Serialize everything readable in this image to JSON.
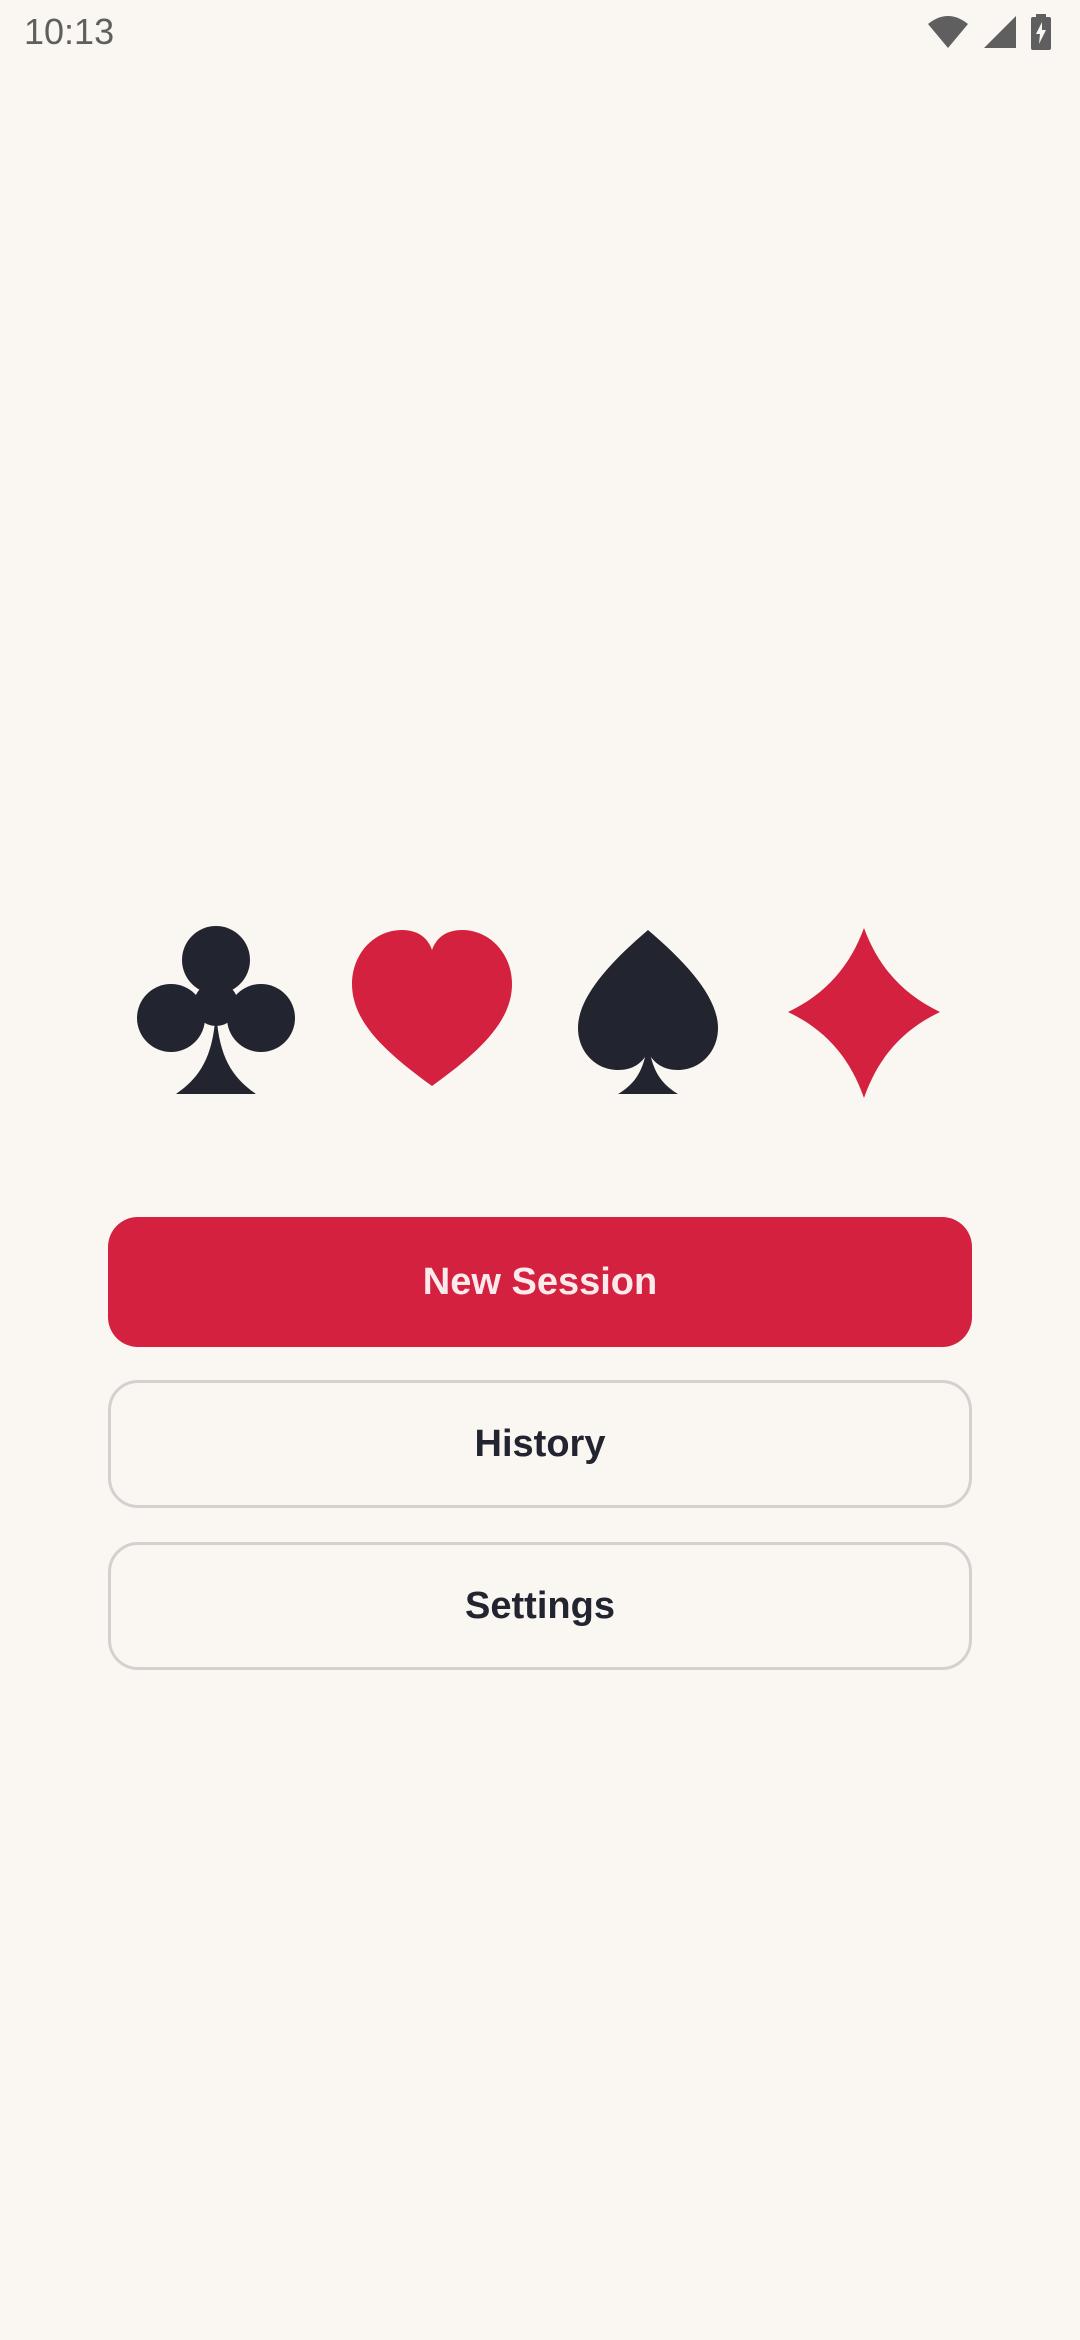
{
  "status_bar": {
    "time": "10:13",
    "icons": [
      "wifi-icon",
      "cell-signal-icon",
      "battery-charging-icon"
    ]
  },
  "suits": [
    {
      "name": "club-icon",
      "color": "#22252F"
    },
    {
      "name": "heart-icon",
      "color": "#D3213F"
    },
    {
      "name": "spade-icon",
      "color": "#22252F"
    },
    {
      "name": "diamond-icon",
      "color": "#D3213F"
    }
  ],
  "menu": {
    "new_session_label": "New Session",
    "history_label": "History",
    "settings_label": "Settings"
  },
  "colors": {
    "background": "#FAF7F3",
    "accent": "#D3213F",
    "dark": "#22252F",
    "outline": "#D5D0CD"
  }
}
